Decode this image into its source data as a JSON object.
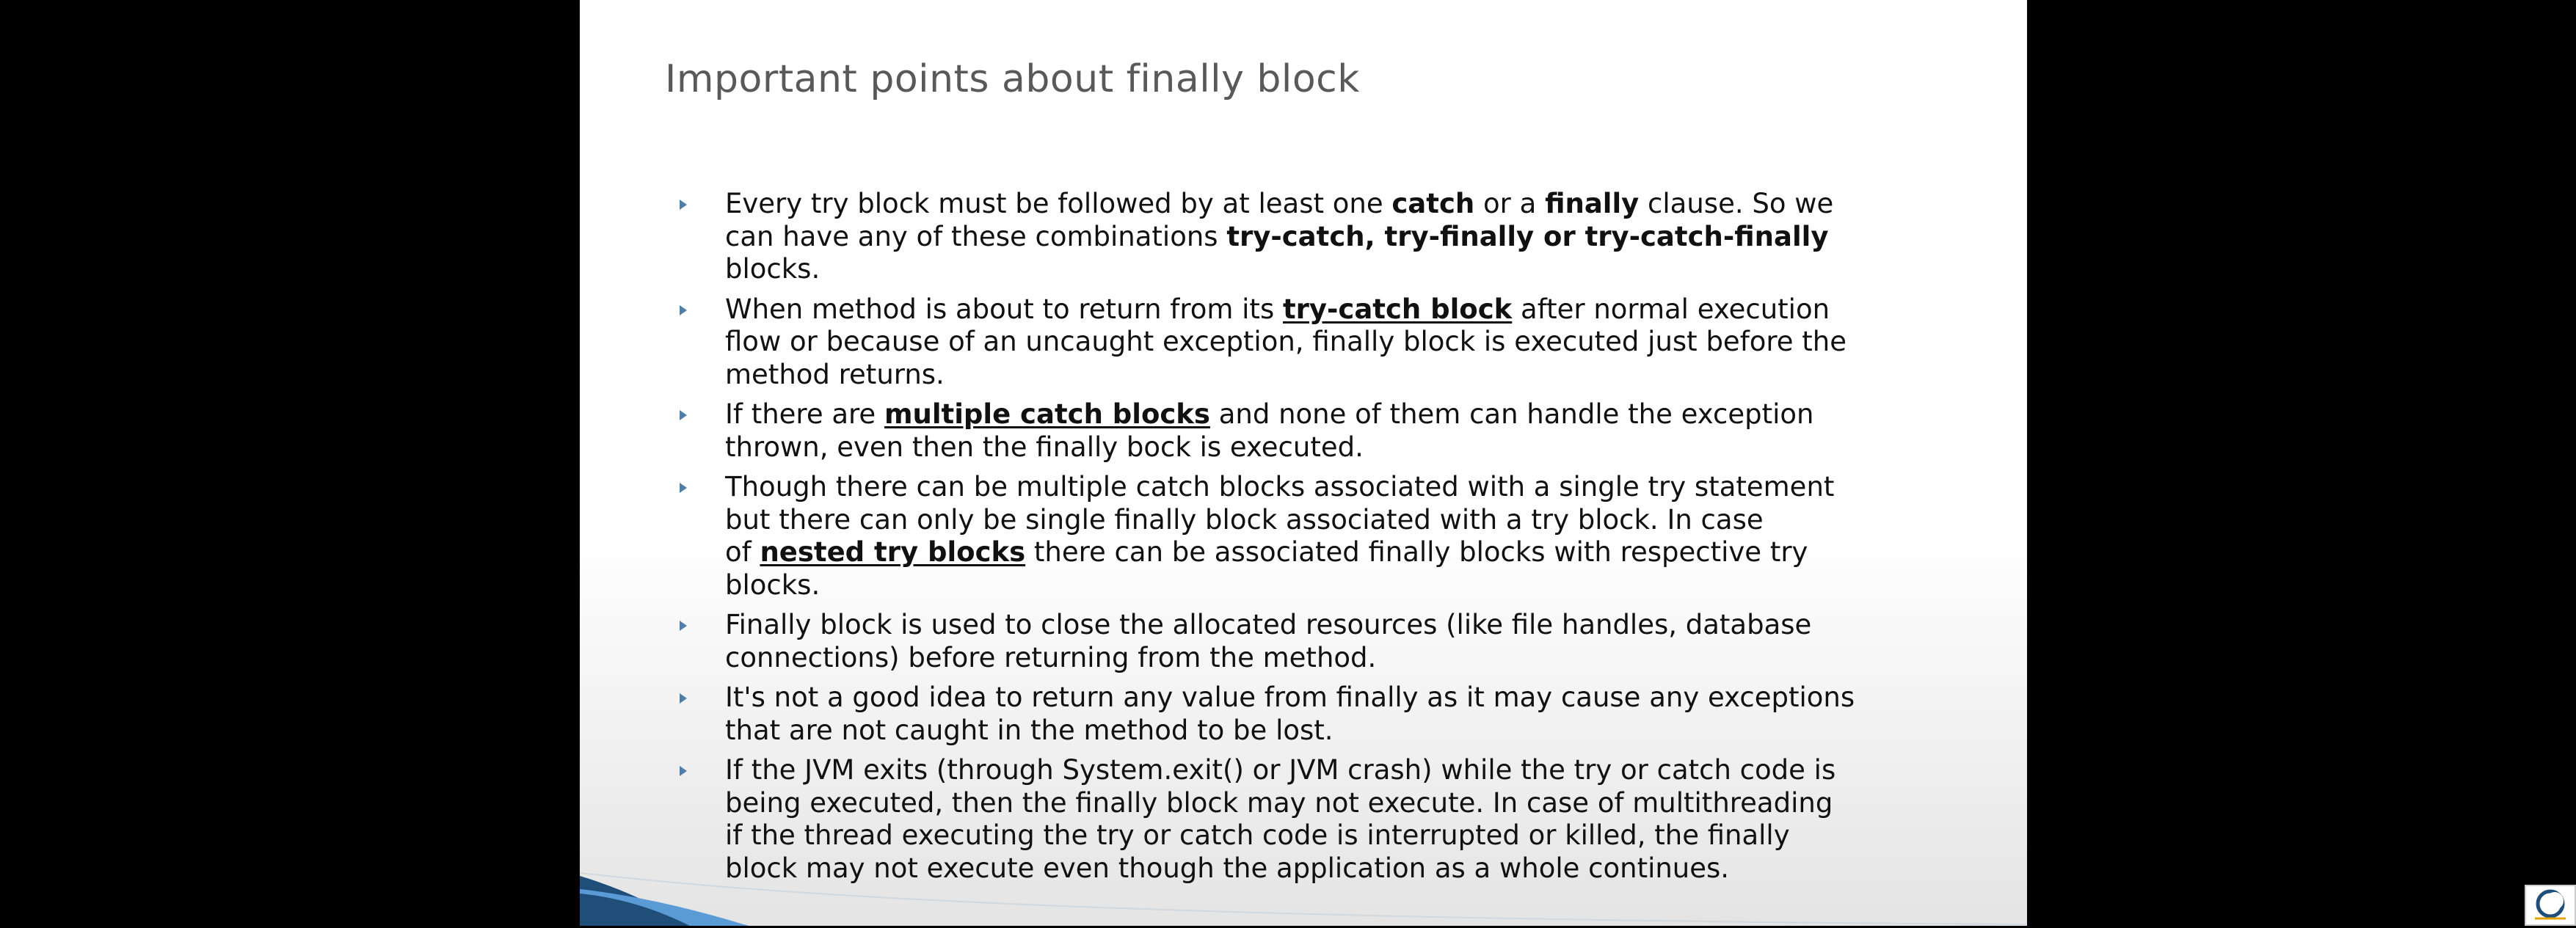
{
  "slide": {
    "title": "Important points about finally block",
    "bullets": [
      {
        "lines": [
          [
            {
              "text": "Every try block must be followed by at least one ",
              "style": "normal"
            },
            {
              "text": "catch",
              "style": "bold"
            },
            {
              "text": " or a ",
              "style": "normal"
            },
            {
              "text": "finally",
              "style": "bold"
            },
            {
              "text": " clause. So we",
              "style": "normal"
            }
          ],
          [
            {
              "text": "can have any of these combinations ",
              "style": "normal"
            },
            {
              "text": "try-catch, try-finally or try-catch-finally",
              "style": "bold"
            }
          ],
          [
            {
              "text": "blocks.",
              "style": "normal"
            }
          ]
        ]
      },
      {
        "lines": [
          [
            {
              "text": "When method is about to return from its ",
              "style": "normal"
            },
            {
              "text": "try-catch block",
              "style": "bold-underline"
            },
            {
              "text": " after normal execution",
              "style": "normal"
            }
          ],
          [
            {
              "text": "flow or because of an uncaught exception, finally block is executed just before the",
              "style": "normal"
            }
          ],
          [
            {
              "text": "method returns.",
              "style": "normal"
            }
          ]
        ]
      },
      {
        "lines": [
          [
            {
              "text": "If there are ",
              "style": "normal"
            },
            {
              "text": "multiple catch blocks",
              "style": "bold-underline"
            },
            {
              "text": " and none of them can handle the exception",
              "style": "normal"
            }
          ],
          [
            {
              "text": "thrown, even then the finally bock is executed.",
              "style": "normal"
            }
          ]
        ]
      },
      {
        "lines": [
          [
            {
              "text": "Though there can be multiple catch blocks associated with a single try statement",
              "style": "normal"
            }
          ],
          [
            {
              "text": "but there can only be single finally block associated with a try block. In case",
              "style": "normal"
            }
          ],
          [
            {
              "text": "of ",
              "style": "normal"
            },
            {
              "text": "nested try blocks",
              "style": "bold-underline"
            },
            {
              "text": " there can be associated finally blocks with respective try",
              "style": "normal"
            }
          ],
          [
            {
              "text": "blocks.",
              "style": "normal"
            }
          ]
        ]
      },
      {
        "lines": [
          [
            {
              "text": "Finally block is used to close the allocated resources (like file handles, database",
              "style": "normal"
            }
          ],
          [
            {
              "text": "connections) before returning from the method.",
              "style": "normal"
            }
          ]
        ]
      },
      {
        "lines": [
          [
            {
              "text": "It's not a good idea to return any value from finally as it may cause any exceptions",
              "style": "normal"
            }
          ],
          [
            {
              "text": "that are not caught in the method to be lost.",
              "style": "normal"
            }
          ]
        ]
      },
      {
        "lines": [
          [
            {
              "text": "If the JVM exits (through System.exit() or JVM crash) while the try or catch code is",
              "style": "normal"
            }
          ],
          [
            {
              "text": "being executed, then the finally block may not execute. In case of multithreading",
              "style": "normal"
            }
          ],
          [
            {
              "text": "if the thread executing the try or catch code is interrupted or killed, the finally",
              "style": "normal"
            }
          ],
          [
            {
              "text": "block may not execute even though the application as a whole continues.",
              "style": "normal"
            }
          ]
        ]
      }
    ]
  },
  "colors": {
    "letterbox": "#000000",
    "slide_background": "#ffffff",
    "title_text": "#595959",
    "body_text": "#111111",
    "bullet_marker": "#4f7fa8",
    "swoosh_dark": "#1f4e79",
    "swoosh_light": "#5b9bd5"
  },
  "icons": {
    "bullet": "triangle-bullet-icon",
    "corner": "channel-logo-icon"
  }
}
